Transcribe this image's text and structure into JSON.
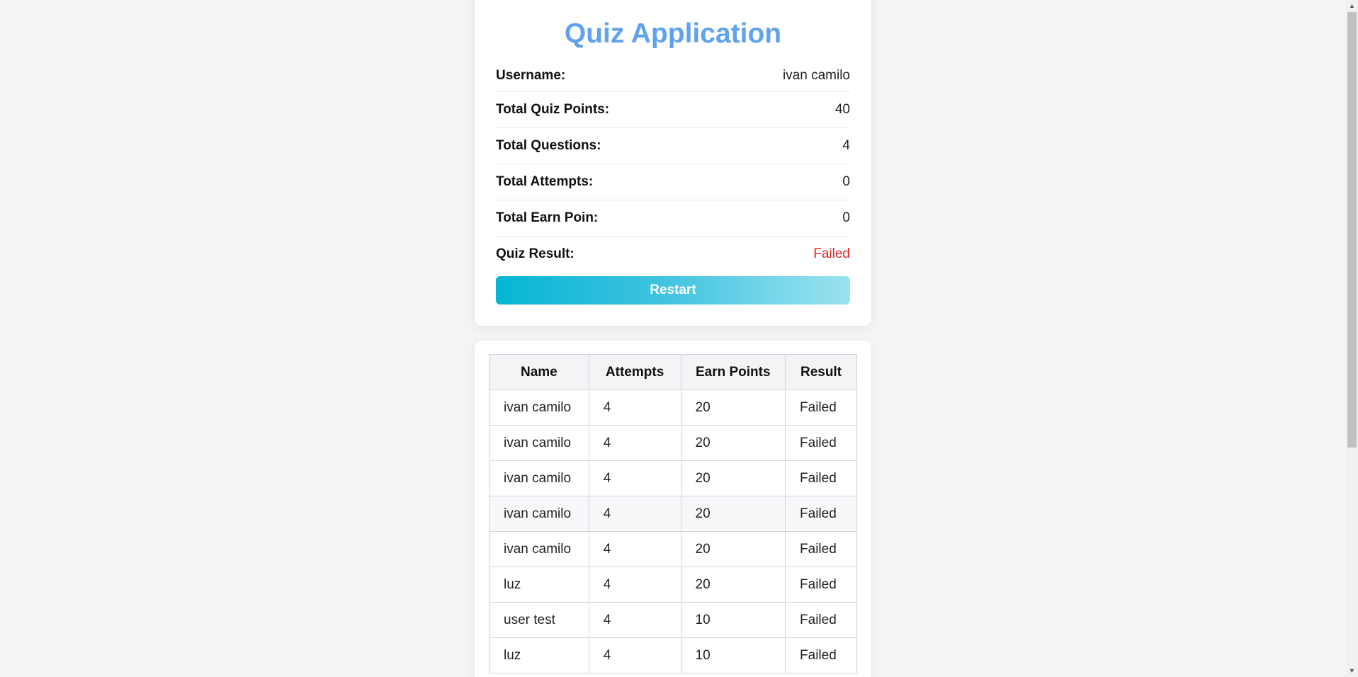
{
  "app": {
    "title": "Quiz Application"
  },
  "summary": {
    "username_label": "Username:",
    "username_value": "ivan camilo",
    "total_points_label": "Total Quiz Points:",
    "total_points_value": "40",
    "total_questions_label": "Total Questions:",
    "total_questions_value": "4",
    "total_attempts_label": "Total Attempts:",
    "total_attempts_value": "0",
    "total_earn_label": "Total Earn Poin:",
    "total_earn_value": "0",
    "result_label": "Quiz Result:",
    "result_value": "Failed",
    "result_color": "#dc2626",
    "restart_label": "Restart"
  },
  "results_table": {
    "headers": [
      "Name",
      "Attempts",
      "Earn Points",
      "Result"
    ],
    "rows": [
      [
        "ivan camilo",
        "4",
        "20",
        "Failed"
      ],
      [
        "ivan camilo",
        "4",
        "20",
        "Failed"
      ],
      [
        "ivan camilo",
        "4",
        "20",
        "Failed"
      ],
      [
        "ivan camilo",
        "4",
        "20",
        "Failed"
      ],
      [
        "ivan camilo",
        "4",
        "20",
        "Failed"
      ],
      [
        "luz",
        "4",
        "20",
        "Failed"
      ],
      [
        "user test",
        "4",
        "10",
        "Failed"
      ],
      [
        "luz",
        "4",
        "10",
        "Failed"
      ]
    ]
  },
  "colors": {
    "title": "#5fa2ee",
    "button_gradient_start": "#06b6d4",
    "button_gradient_end": "#9be3ef",
    "background": "#f3f4f6"
  },
  "icons": {
    "scroll_up": "▲",
    "scroll_down": "▼"
  }
}
